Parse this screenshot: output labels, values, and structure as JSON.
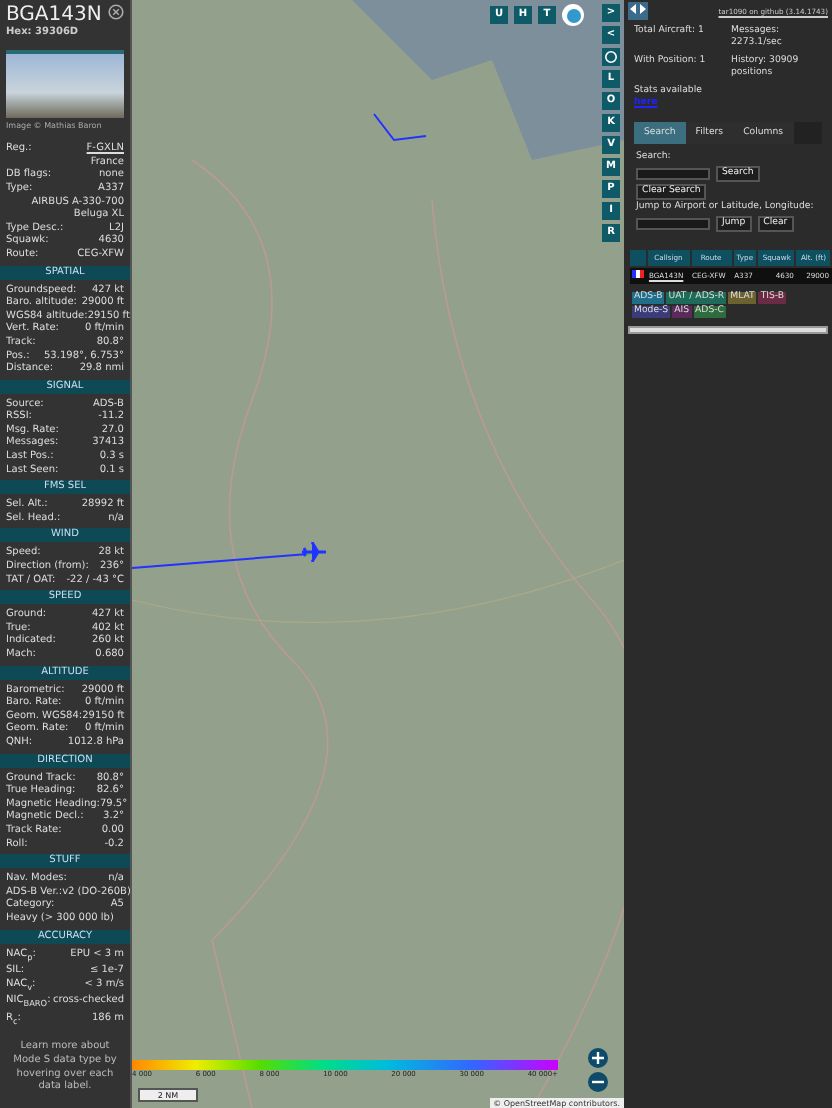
{
  "aircraft": {
    "callsign": "BGA143N",
    "hex": "Hex: 39306D",
    "photo_credit": "Image © Mathias Baron"
  },
  "sections": [
    {
      "rows": [
        {
          "kind": "pair",
          "label": "Reg.:",
          "value": "F-GXLN",
          "link": true
        },
        {
          "kind": "line",
          "value": "France"
        },
        {
          "kind": "pair",
          "label": "DB flags:",
          "value": "none"
        },
        {
          "kind": "pair",
          "label": "Type:",
          "value": "A337"
        },
        {
          "kind": "line",
          "value": "AIRBUS A-330-700 Beluga XL"
        },
        {
          "kind": "pair",
          "label": "Type Desc.:",
          "value": "L2J"
        },
        {
          "kind": "pair",
          "label": "Squawk:",
          "value": "4630"
        },
        {
          "kind": "pair",
          "label": "Route:",
          "value": "CEG-XFW"
        }
      ]
    },
    {
      "title": "SPATIAL",
      "rows": [
        {
          "kind": "pair",
          "label": "Groundspeed:",
          "value": "427 kt"
        },
        {
          "kind": "pair",
          "label": "Baro. altitude:",
          "value": "29000 ft"
        },
        {
          "kind": "pair",
          "label": "WGS84 altitude:",
          "value": "29150 ft"
        },
        {
          "kind": "pair",
          "label": "Vert. Rate:",
          "value": "0 ft/min"
        },
        {
          "kind": "pair",
          "label": "Track:",
          "value": "80.8°"
        },
        {
          "kind": "pair",
          "label": "Pos.:",
          "value": "53.198°, 6.753°"
        },
        {
          "kind": "pair",
          "label": "Distance:",
          "value": "29.8 nmi"
        }
      ]
    },
    {
      "title": "SIGNAL",
      "rows": [
        {
          "kind": "pair",
          "label": "Source:",
          "value": "ADS-B"
        },
        {
          "kind": "pair",
          "label": "RSSI:",
          "value": "-11.2"
        },
        {
          "kind": "pair",
          "label": "Msg. Rate:",
          "value": "27.0"
        },
        {
          "kind": "pair",
          "label": "Messages:",
          "value": "37413"
        },
        {
          "kind": "pair",
          "label": "Last Pos.:",
          "value": "0.3 s"
        },
        {
          "kind": "pair",
          "label": "Last Seen:",
          "value": "0.1 s"
        }
      ]
    },
    {
      "title": "FMS SEL",
      "rows": [
        {
          "kind": "pair",
          "label": "Sel. Alt.:",
          "value": "28992 ft"
        },
        {
          "kind": "pair",
          "label": "Sel. Head.:",
          "value": "n/a"
        }
      ]
    },
    {
      "title": "WIND",
      "rows": [
        {
          "kind": "pair",
          "label": "Speed:",
          "value": "28 kt"
        },
        {
          "kind": "pair",
          "label": "Direction (from):",
          "value": "236°"
        },
        {
          "kind": "pair",
          "label": "TAT / OAT:",
          "value": "-22 / -43 °C"
        }
      ]
    },
    {
      "title": "SPEED",
      "rows": [
        {
          "kind": "pair",
          "label": "Ground:",
          "value": "427 kt"
        },
        {
          "kind": "pair",
          "label": "True:",
          "value": "402 kt"
        },
        {
          "kind": "pair",
          "label": "Indicated:",
          "value": "260 kt"
        },
        {
          "kind": "pair",
          "label": "Mach:",
          "value": "0.680"
        }
      ]
    },
    {
      "title": "ALTITUDE",
      "rows": [
        {
          "kind": "pair",
          "label": "Barometric:",
          "value": "29000 ft"
        },
        {
          "kind": "pair",
          "label": "Baro. Rate:",
          "value": "0 ft/min"
        },
        {
          "kind": "pair",
          "label": "Geom. WGS84:",
          "value": "29150 ft"
        },
        {
          "kind": "pair",
          "label": "Geom. Rate:",
          "value": "0 ft/min"
        },
        {
          "kind": "pair",
          "label": "QNH:",
          "value": "1012.8 hPa"
        }
      ]
    },
    {
      "title": "DIRECTION",
      "rows": [
        {
          "kind": "pair",
          "label": "Ground Track:",
          "value": "80.8°"
        },
        {
          "kind": "pair",
          "label": "True Heading:",
          "value": "82.6°"
        },
        {
          "kind": "pair",
          "label": "Magnetic Heading:",
          "value": "79.5°"
        },
        {
          "kind": "pair",
          "label": "Magnetic Decl.:",
          "value": "3.2°"
        },
        {
          "kind": "pair",
          "label": "Track Rate:",
          "value": "0.00"
        },
        {
          "kind": "pair",
          "label": "Roll:",
          "value": "-0.2"
        }
      ]
    },
    {
      "title": "STUFF",
      "rows": [
        {
          "kind": "pair",
          "label": "Nav. Modes:",
          "value": "n/a"
        },
        {
          "kind": "pair",
          "label": "ADS-B Ver.:",
          "value": "v2 (DO-260B)"
        },
        {
          "kind": "pair",
          "label": "Category:",
          "value": "A5"
        },
        {
          "kind": "left",
          "value": "Heavy (> 300 000 lb)"
        }
      ]
    },
    {
      "title": "ACCURACY",
      "rows": [
        {
          "kind": "pair",
          "label": "NAC$_{p}$:",
          "value": "EPU < 3 m"
        },
        {
          "kind": "pair",
          "label": "SIL:",
          "value": "≤ 1e-7"
        },
        {
          "kind": "pair",
          "label": "NAC$_{v}$:",
          "value": "< 3 m/s"
        },
        {
          "kind": "pair",
          "label": "NIC$_{BARO}$:",
          "value": "cross-checked"
        },
        {
          "kind": "pair",
          "label": "R$_{c}$:",
          "value": "186 m"
        },
        {
          "kind": "note",
          "value": "Learn more about Mode S data type by hovering over each data label."
        }
      ]
    }
  ],
  "map": {
    "top_buttons": [
      "U",
      "H",
      "T"
    ],
    "side_buttons": [
      ">",
      "<",
      "L",
      "O",
      "K",
      "V",
      "M",
      "P",
      "I",
      "R"
    ],
    "scale": "2 NM",
    "attribution": "© OpenStreetMap contributors.",
    "altitude_legend": [
      "4 000",
      "6 000",
      "8 000",
      "10 000",
      "20 000",
      "30 000",
      "40 000+"
    ]
  },
  "panel": {
    "version_link": "tar1090 on github (3.14.1743)",
    "stats": [
      {
        "label": "Total Aircraft: 1"
      },
      {
        "label": "Messages: 2273.1/sec"
      },
      {
        "label": "With Position: 1"
      },
      {
        "label": "History: 30909 positions"
      }
    ],
    "stats_text": "Stats available",
    "stats_link": "here",
    "tabs": [
      {
        "label": "Search",
        "selected": true
      },
      {
        "label": "Filters",
        "selected": false
      },
      {
        "label": "Columns",
        "selected": false
      }
    ],
    "search_label": "Search:",
    "search_button": "Search",
    "clear_search_button": "Clear Search",
    "jump_label": "Jump to Airport or Latitude, Longitude:",
    "jump_button": "Jump",
    "clear_button": "Clear",
    "columns": [
      "Callsign",
      "Route",
      "Type",
      "Squawk",
      "Alt. (ft)"
    ],
    "rows": [
      {
        "callsign": "BGA143N",
        "route": "CEG-XFW",
        "type": "A337",
        "squawk": "4630",
        "alt": "29000",
        "selected": true
      }
    ],
    "legend": [
      {
        "label": "ADS-B",
        "color": "#1f6f8b"
      },
      {
        "label": "UAT / ADS-R",
        "color": "#1e6b5a"
      },
      {
        "label": "MLAT",
        "color": "#6b6230"
      },
      {
        "label": "TIS-B",
        "color": "#6b2b45"
      },
      {
        "label": "Mode-S",
        "color": "#3b3b7a"
      },
      {
        "label": "AIS",
        "color": "#5a2a5a"
      },
      {
        "label": "ADS-C",
        "color": "#2e6b3e"
      }
    ]
  }
}
